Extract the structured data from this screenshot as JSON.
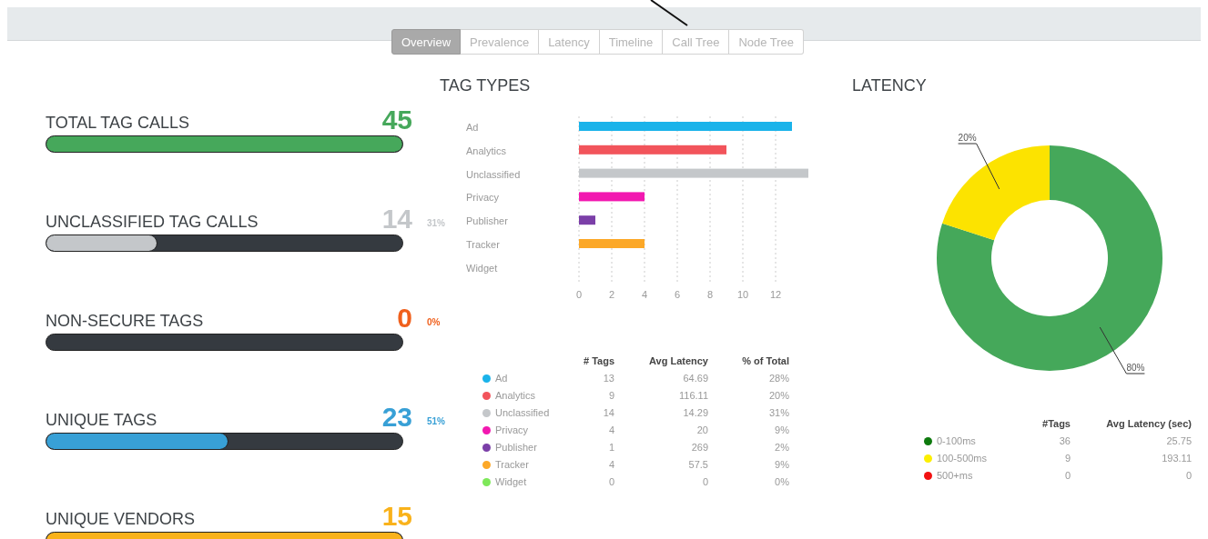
{
  "tabs": [
    {
      "label": "Overview",
      "selected": true
    },
    {
      "label": "Prevalence",
      "selected": false
    },
    {
      "label": "Latency",
      "selected": false
    },
    {
      "label": "Timeline",
      "selected": false
    },
    {
      "label": "Call Tree",
      "selected": false
    },
    {
      "label": "Node Tree",
      "selected": false
    }
  ],
  "metrics": [
    {
      "label": "TOTAL TAG CALLS",
      "value": "45",
      "level": 1,
      "color": "#46a85b"
    },
    {
      "label": "UNCLASSIFIED TAG CALLS",
      "value": "14",
      "percent": "31%",
      "level": 0.31,
      "color": "#c4c7ca"
    },
    {
      "label": "NON-SECURE TAGS",
      "value": "0",
      "percent": "0%",
      "level": 0,
      "color": "#f0601c"
    },
    {
      "label": "UNIQUE TAGS",
      "value": "23",
      "percent": "51%",
      "level": 0.51,
      "color": "#38a0d6"
    },
    {
      "label": "UNIQUE VENDORS",
      "value": "15",
      "level": 1,
      "color": "#f9b21b"
    }
  ],
  "tag_types": {
    "title": "TAG TYPES",
    "chart_data": {
      "type": "bar",
      "orientation": "horizontal",
      "categories": [
        "Ad",
        "Analytics",
        "Unclassified",
        "Privacy",
        "Publisher",
        "Tracker",
        "Widget"
      ],
      "series": [
        {
          "values": [
            13,
            9,
            14,
            4,
            1,
            4,
            0
          ]
        }
      ],
      "grid": true,
      "xlim": [
        0,
        14
      ],
      "xticks": [
        0,
        2,
        4,
        6,
        8,
        10,
        12
      ]
    },
    "table": {
      "columns": [
        "# Tags",
        "Avg Latency",
        "% of Total"
      ],
      "rows": [
        {
          "name": "Ad",
          "color": "#1ab3ea",
          "cells": [
            "13",
            "64.69",
            "28%"
          ]
        },
        {
          "name": "Analytics",
          "color": "#f2545b",
          "cells": [
            "9",
            "116.11",
            "20%"
          ]
        },
        {
          "name": "Unclassified",
          "color": "#c4c7ca",
          "cells": [
            "14",
            "14.29",
            "31%"
          ]
        },
        {
          "name": "Privacy",
          "color": "#f218b0",
          "cells": [
            "4",
            "20",
            "9%"
          ]
        },
        {
          "name": "Publisher",
          "color": "#7b3fa8",
          "cells": [
            "1",
            "269",
            "2%"
          ]
        },
        {
          "name": "Tracker",
          "color": "#fca828",
          "cells": [
            "4",
            "57.5",
            "9%"
          ]
        },
        {
          "name": "Widget",
          "color": "#7ee85a",
          "cells": [
            "0",
            "0",
            "0%"
          ]
        }
      ]
    }
  },
  "latency": {
    "title": "LATENCY",
    "chart_data": {
      "type": "donut",
      "series": [
        {
          "values": [
            80,
            20
          ]
        }
      ],
      "colors": [
        "#45a85a",
        "#fce300"
      ],
      "value_labels": [
        "80%",
        "20%"
      ]
    },
    "table": {
      "columns": [
        "#Tags",
        "Avg Latency (sec)"
      ],
      "rows": [
        {
          "name": "0-100ms",
          "color": "#0e7a0e",
          "cells": [
            "36",
            "25.75"
          ]
        },
        {
          "name": "100-500ms",
          "color": "#fcef00",
          "cells": [
            "9",
            "193.11"
          ]
        },
        {
          "name": "500+ms",
          "color": "#f21010",
          "cells": [
            "0",
            "0"
          ]
        }
      ]
    }
  }
}
